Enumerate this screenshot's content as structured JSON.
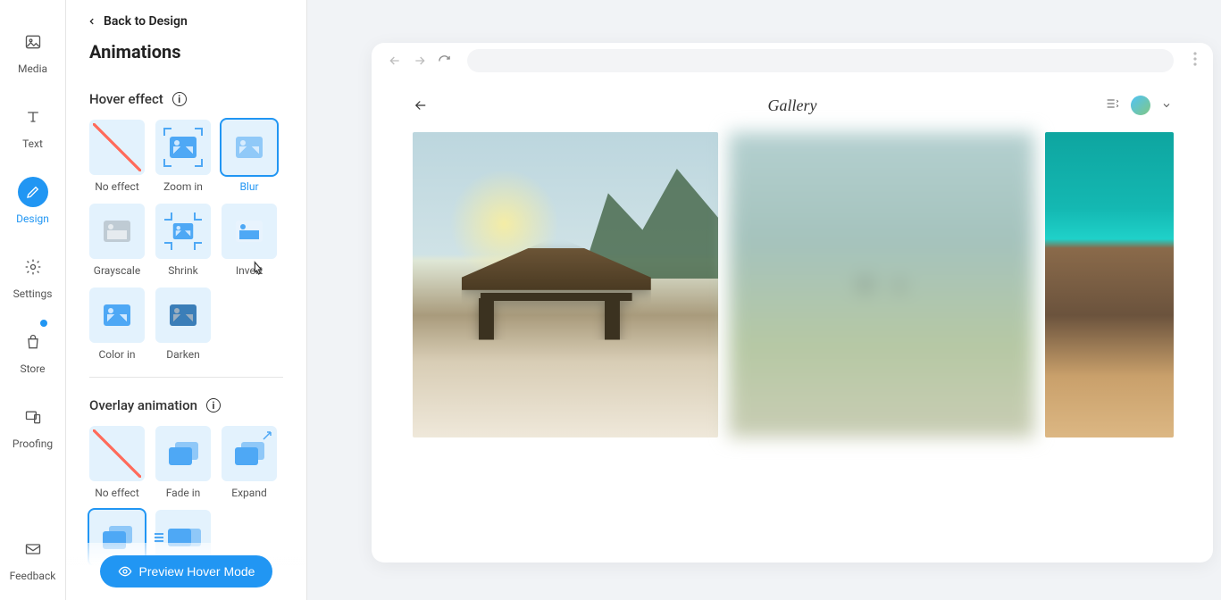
{
  "nav_rail": {
    "items": [
      {
        "key": "media",
        "label": "Media",
        "icon": "image-icon"
      },
      {
        "key": "text",
        "label": "Text",
        "icon": "text-icon"
      },
      {
        "key": "design",
        "label": "Design",
        "icon": "pencil-icon",
        "active": true
      },
      {
        "key": "settings",
        "label": "Settings",
        "icon": "gear-icon"
      },
      {
        "key": "store",
        "label": "Store",
        "icon": "bag-icon",
        "badge": true
      },
      {
        "key": "proofing",
        "label": "Proofing",
        "icon": "device-icon"
      }
    ],
    "footer": {
      "key": "feedback",
      "label": "Feedback",
      "icon": "mail-icon"
    }
  },
  "sidebar": {
    "back_label": "Back to Design",
    "title": "Animations",
    "sections": {
      "hover": {
        "label": "Hover effect",
        "options": [
          {
            "key": "none",
            "label": "No effect"
          },
          {
            "key": "zoomin",
            "label": "Zoom in"
          },
          {
            "key": "blur",
            "label": "Blur",
            "selected": true,
            "hovered": true
          },
          {
            "key": "grayscale",
            "label": "Grayscale"
          },
          {
            "key": "shrink",
            "label": "Shrink"
          },
          {
            "key": "invert",
            "label": "Invert"
          },
          {
            "key": "colorin",
            "label": "Color in"
          },
          {
            "key": "darken",
            "label": "Darken"
          }
        ]
      },
      "overlay": {
        "label": "Overlay animation",
        "options": [
          {
            "key": "none",
            "label": "No effect"
          },
          {
            "key": "fadein",
            "label": "Fade in"
          },
          {
            "key": "expand",
            "label": "Expand"
          },
          {
            "key": "slideup",
            "label": "",
            "selected": true
          },
          {
            "key": "slidein",
            "label": ""
          }
        ]
      }
    },
    "preview_button": "Preview Hover Mode"
  },
  "preview": {
    "page_title": "Gallery"
  }
}
